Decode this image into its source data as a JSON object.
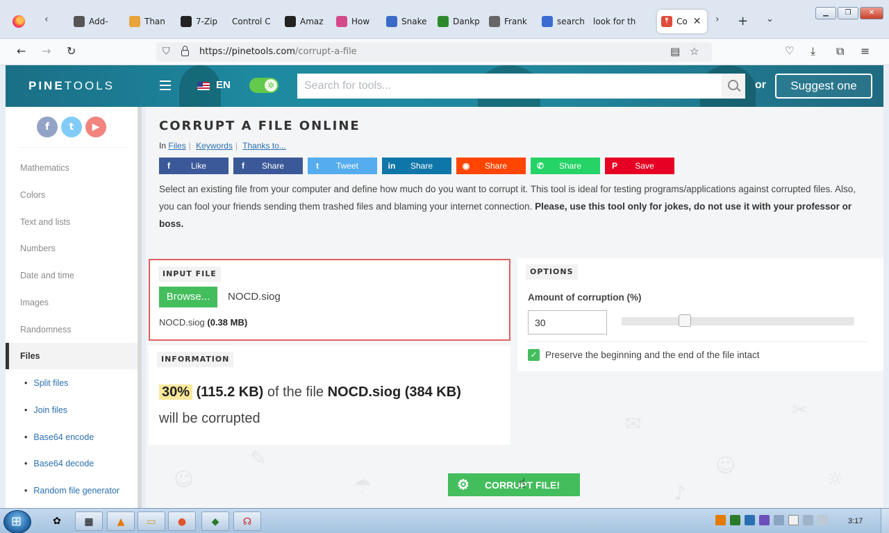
{
  "browser": {
    "tabs": [
      {
        "label": "Add-",
        "icon": "puzzle-icon",
        "color": "#555555"
      },
      {
        "label": "Than",
        "icon": "smiley-icon",
        "color": "#e8a33a"
      },
      {
        "label": "7-Zip",
        "icon": "7zip-icon",
        "color": "#222222"
      },
      {
        "label": "Control C",
        "icon": "",
        "color": ""
      },
      {
        "label": "Amaz",
        "icon": "amazon-icon",
        "color": "#222222"
      },
      {
        "label": "How",
        "icon": "how-icon",
        "color": "#d44a8b"
      },
      {
        "label": "Snake",
        "icon": "snake-icon",
        "color": "#3a6cc7"
      },
      {
        "label": "Dankp",
        "icon": "dp-icon",
        "color": "#2c8a2c"
      },
      {
        "label": "Frank",
        "icon": "frank-icon",
        "color": "#666666"
      },
      {
        "label": "search",
        "icon": "search-icon",
        "color": "#3b6cd1"
      },
      {
        "label": "look for th",
        "icon": "",
        "color": ""
      }
    ],
    "active_tab": {
      "label": "Co",
      "icon": "pinetools-icon",
      "color": "#e04b3a"
    },
    "url_domain": "https://pinetools.com",
    "url_path": "/corrupt-a-file"
  },
  "site": {
    "logo_bold": "PINE",
    "logo_rest": "TOOLS",
    "lang": "EN",
    "search_placeholder": "Search for tools...",
    "or_text": "or",
    "suggest_label": "Suggest one"
  },
  "sidebar": {
    "social": [
      {
        "label": "f",
        "color": "#3b5998"
      },
      {
        "label": "t",
        "color": "#1da1f2"
      },
      {
        "label": "▶",
        "color": "#e62117"
      }
    ],
    "categories": [
      "Mathematics",
      "Colors",
      "Text and lists",
      "Numbers",
      "Date and time",
      "Images",
      "Randomness"
    ],
    "active_category": "Files",
    "subitems": [
      "Split files",
      "Join files",
      "Base64 encode",
      "Base64 decode",
      "Random file generator"
    ]
  },
  "page": {
    "title": "CORRUPT A FILE ONLINE",
    "crumb_prefix": "In",
    "crumbs": [
      "Files",
      "Keywords",
      "Thanks to..."
    ],
    "share_buttons": [
      {
        "label": "Like",
        "icon": "f",
        "color": "#3b5998"
      },
      {
        "label": "Share",
        "icon": "f",
        "color": "#3b5998"
      },
      {
        "label": "Tweet",
        "icon": "t",
        "color": "#55acee"
      },
      {
        "label": "Share",
        "icon": "in",
        "color": "#0e76a8"
      },
      {
        "label": "Share",
        "icon": "◉",
        "color": "#ff4500"
      },
      {
        "label": "Share",
        "icon": "✆",
        "color": "#25d366"
      },
      {
        "label": "Save",
        "icon": "P",
        "color": "#e60023"
      }
    ],
    "description_plain": "Select an existing file from your computer and define how much do you want to corrupt it. This tool is ideal for testing programs/applications against corrupted files. Also, you can fool your friends sending them trashed files and blaming your internet connection. ",
    "description_bold": "Please, use this tool only for jokes, do not use it with your professor or boss."
  },
  "input_panel": {
    "label": "INPUT FILE",
    "browse_label": "Browse...",
    "file_name": "NOCD.siog",
    "file_info_name": "NOCD.siog",
    "file_info_size": "(0.38 MB)"
  },
  "info_panel": {
    "label": "INFORMATION",
    "percent": "30%",
    "amount": "(115.2 KB)",
    "mid_text": "of the file",
    "file": "NOCD.siog (384 KB)",
    "tail_text": "will be corrupted"
  },
  "options_panel": {
    "label": "OPTIONS",
    "heading": "Amount of corruption (%)",
    "value": "30",
    "slider_fraction": 0.3,
    "checkbox_checked": true,
    "checkbox_label": "Preserve the beginning and the end of the file intact"
  },
  "action": {
    "label": "CORRUPT FILE!"
  },
  "taskbar": {
    "clock": "3:17"
  }
}
